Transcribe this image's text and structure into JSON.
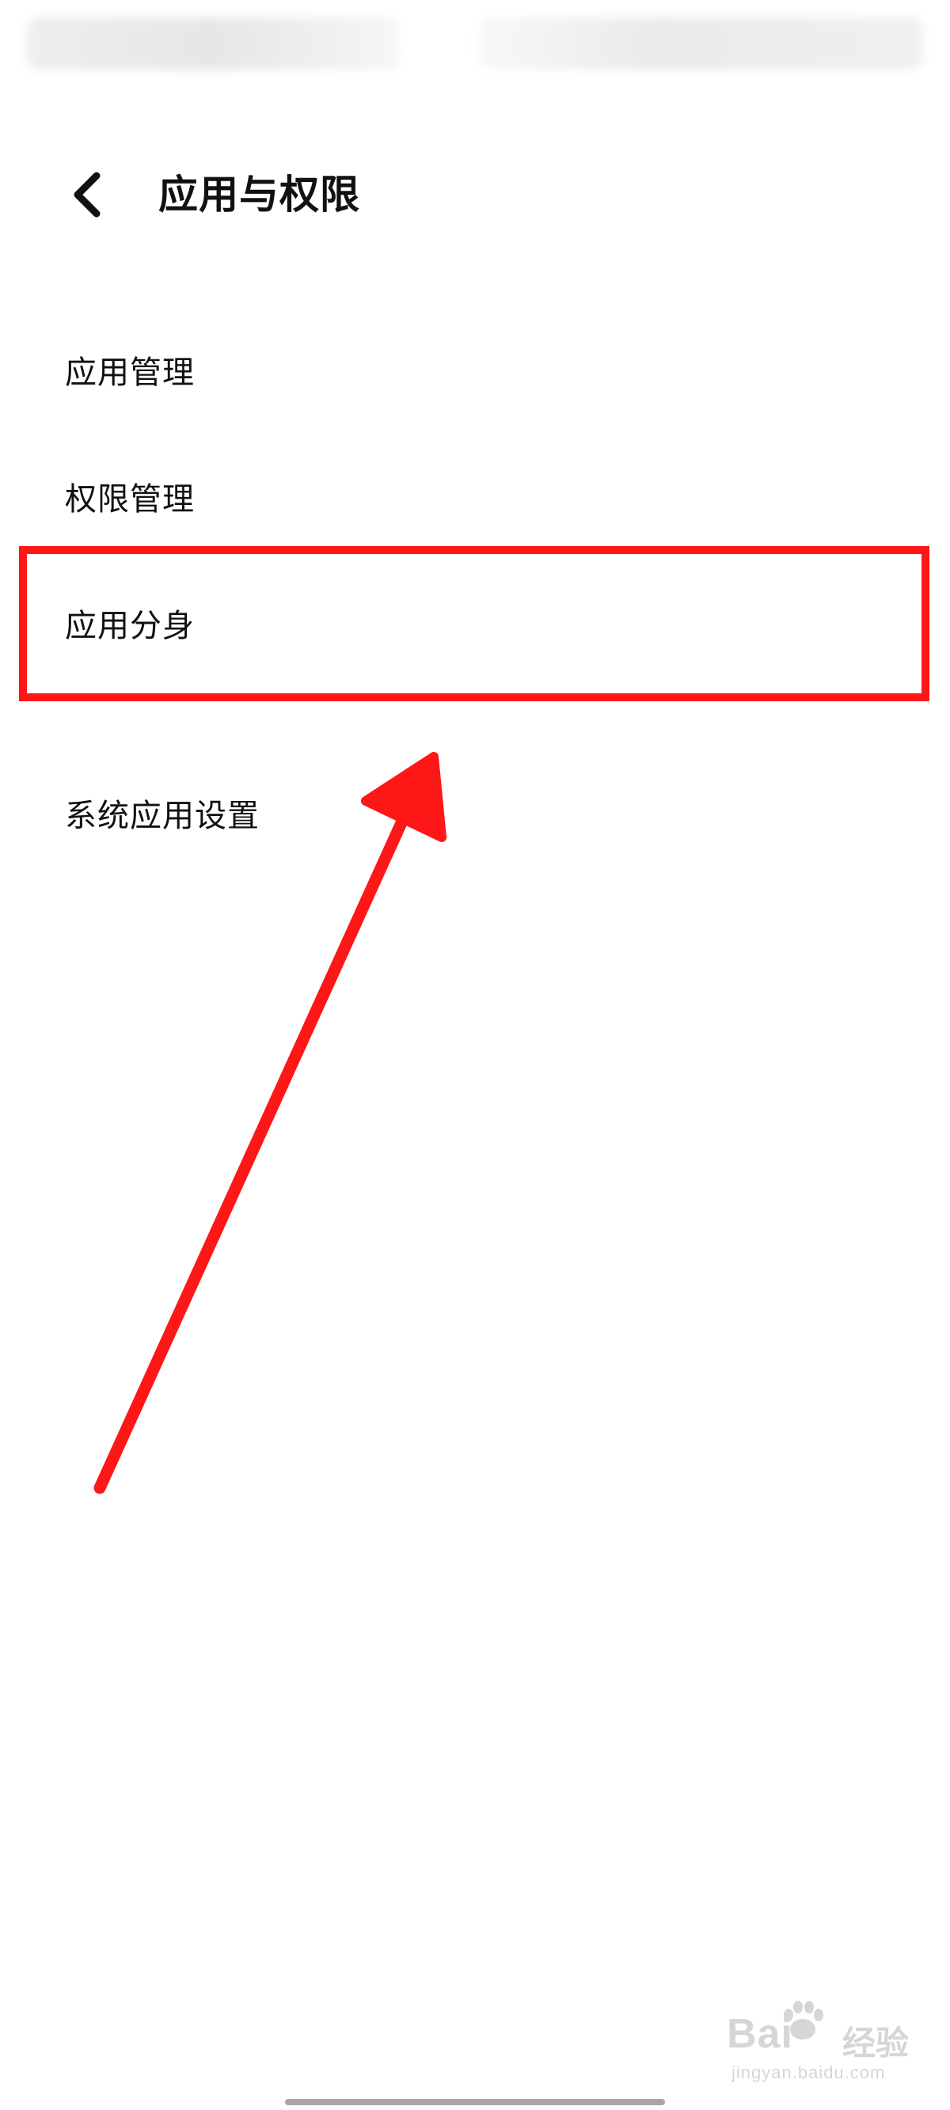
{
  "header": {
    "back_icon": "chevron-left-icon",
    "title": "应用与权限"
  },
  "menu": {
    "items": [
      {
        "label": "应用管理"
      },
      {
        "label": "权限管理"
      },
      {
        "label": "应用分身"
      },
      {
        "label": "系统应用设置"
      }
    ]
  },
  "annotation": {
    "color": "#ff1616",
    "highlighted_item": "应用分身"
  },
  "watermark": {
    "brand": "Bai",
    "jingyan": "经验",
    "url": "jingyan.baidu.com"
  }
}
